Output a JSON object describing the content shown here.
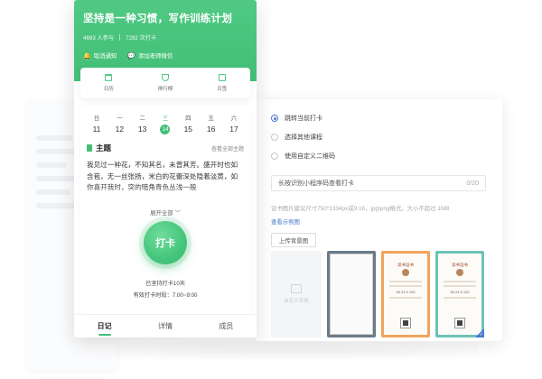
{
  "hero": {
    "title": "坚持是一种习惯，写作训练计划",
    "participants": "4693 人参与",
    "checkins": "7292 次打卡",
    "cancel_notify": "取消通知",
    "add_teacher": "添加老师微信"
  },
  "menu": {
    "diary": "日历",
    "ranking": "排行榜",
    "calendar": "日签"
  },
  "calendar": {
    "days": [
      {
        "w": "日",
        "d": "11"
      },
      {
        "w": "一",
        "d": "12"
      },
      {
        "w": "二",
        "d": "13"
      },
      {
        "w": "三",
        "d": "14"
      },
      {
        "w": "四",
        "d": "15"
      },
      {
        "w": "五",
        "d": "16"
      },
      {
        "w": "六",
        "d": "17"
      }
    ]
  },
  "topic": {
    "title": "主题",
    "view_all": "查看全部主题",
    "body": "我见过一种花，不知其名，未曾其芳。盛开时也如含苞，无一丝张扬，米白的花蕾深处隐着淡黄，如你喜开我时，突的暗角青色丛浅一般",
    "expand": "展开全部"
  },
  "checkin": {
    "label": "打卡",
    "streak": "已坚持打卡10天",
    "window": "有效打卡时段：7:00~9:00"
  },
  "tabs": {
    "diary": "日记",
    "details": "详情",
    "members": "成员"
  },
  "settings": {
    "option1": "跳转当前打卡",
    "option2": "选择其他课程",
    "option3": "使用自定义二维码",
    "field_value": "长按识别小程序码查看打卡",
    "field_count": "0/20",
    "hint": "证书图片建议尺寸750*1334px或9:16，jpg\\png格式，大小不超过 1MB",
    "sample_link": "查看示例图",
    "upload": "上传背景图",
    "custom_bg": "自定义背景",
    "thumb_title_1": "读书证书",
    "thumb_title_2": "读书证书",
    "thumb_nums_1": "96 24 5 100",
    "thumb_nums_2": "96 24 5 100"
  },
  "colors": {
    "brand_green": "#43bf77",
    "link_blue": "#4a7bd0"
  }
}
